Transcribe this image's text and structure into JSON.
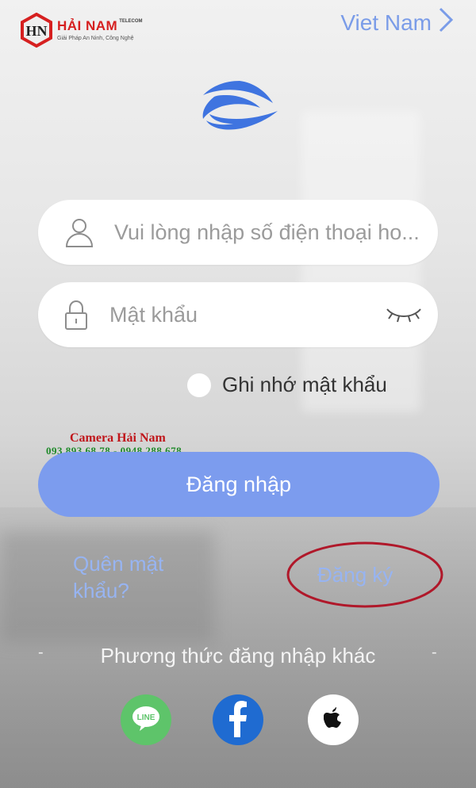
{
  "brand": {
    "name": "HẢI NAM",
    "sub": "TELECOM",
    "tagline": "Giải Pháp An Ninh, Công Nghệ",
    "accent": "#d62020"
  },
  "region": {
    "label": "Viet Nam",
    "icon": "chevron-right-icon",
    "color": "#7a9ce8"
  },
  "app_logo": {
    "icon": "app-logo-icon",
    "color": "#3f74e0"
  },
  "form": {
    "phone": {
      "placeholder": "Vui lòng nhập số điện thoại ho...",
      "icon": "user-icon"
    },
    "password": {
      "placeholder": "Mật khẩu",
      "icon": "lock-icon",
      "toggle_icon": "eye-closed-icon"
    },
    "remember": {
      "label": "Ghi nhớ mật khẩu",
      "checked": false
    },
    "login_button": {
      "label": "Đăng nhập",
      "color": "#7c9cee"
    }
  },
  "watermark": {
    "title": "Camera Hải Nam",
    "phones": "093.893.68.78 - 0948.288.678"
  },
  "links": {
    "forgot": "Quên mật khẩu?",
    "register": "Đăng ký",
    "highlight_color": "#b0182a"
  },
  "other_login": {
    "dash_left": "-",
    "title": "Phương thức đăng nhập khác",
    "dash_right": "-",
    "providers": [
      {
        "name": "line-icon",
        "text": "LINE",
        "color": "#5ec46a"
      },
      {
        "name": "facebook-icon",
        "color": "#1f6bd1"
      },
      {
        "name": "apple-icon",
        "color": "#ffffff"
      }
    ]
  }
}
